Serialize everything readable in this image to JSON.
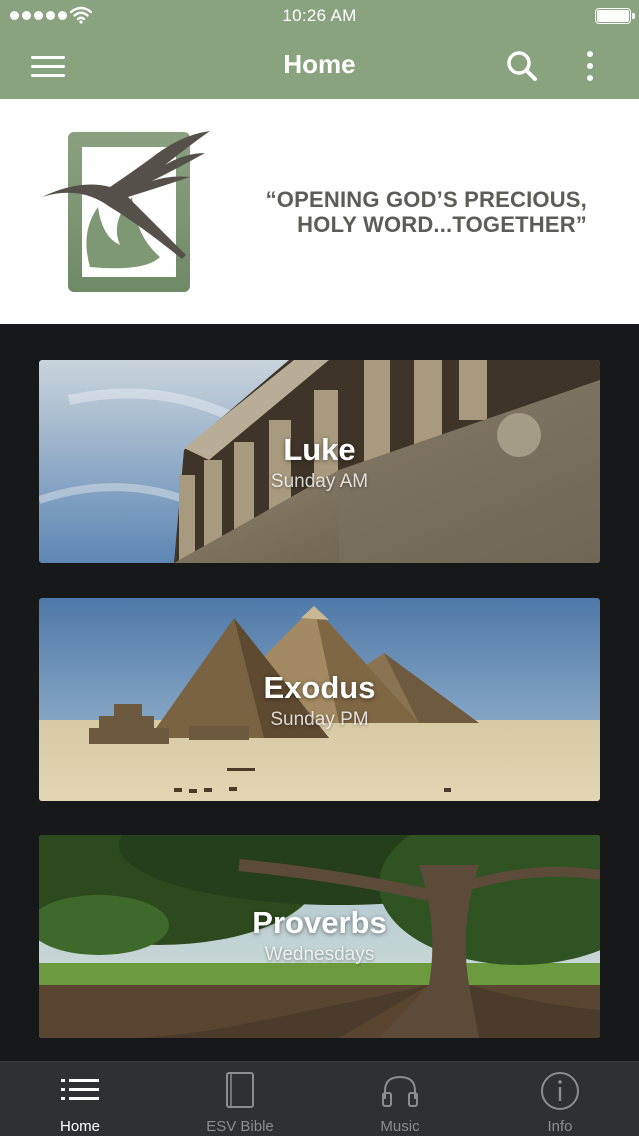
{
  "status_bar": {
    "time": "10:26 AM",
    "signal_icon": "signal-dots-icon",
    "wifi_icon": "wifi-icon",
    "battery_icon": "battery-icon"
  },
  "nav": {
    "title": "Home",
    "menu_icon": "hamburger-menu-icon",
    "search_icon": "search-icon",
    "more_icon": "more-vertical-icon"
  },
  "banner": {
    "logo_icon": "dove-flame-logo",
    "tagline_line1": "“OPENING GOD’S PRECIOUS,",
    "tagline_line2": "HOLY WORD...TOGETHER”"
  },
  "cards": [
    {
      "title": "Luke",
      "subtitle": "Sunday AM",
      "image": "greek-temple-columns"
    },
    {
      "title": "Exodus",
      "subtitle": "Sunday PM",
      "image": "egyptian-pyramids"
    },
    {
      "title": "Proverbs",
      "subtitle": "Wednesdays",
      "image": "large-tree-roots"
    }
  ],
  "tabs": [
    {
      "label": "Home",
      "icon": "list-icon",
      "active": true
    },
    {
      "label": "ESV Bible",
      "icon": "book-icon",
      "active": false
    },
    {
      "label": "Music",
      "icon": "headphones-icon",
      "active": false
    },
    {
      "label": "Info",
      "icon": "info-icon",
      "active": false
    }
  ],
  "colors": {
    "header_green": "#8aa37f",
    "background_dark": "#161819",
    "tabbar": "#2e3032",
    "tagline_gray": "#5c5c58"
  }
}
